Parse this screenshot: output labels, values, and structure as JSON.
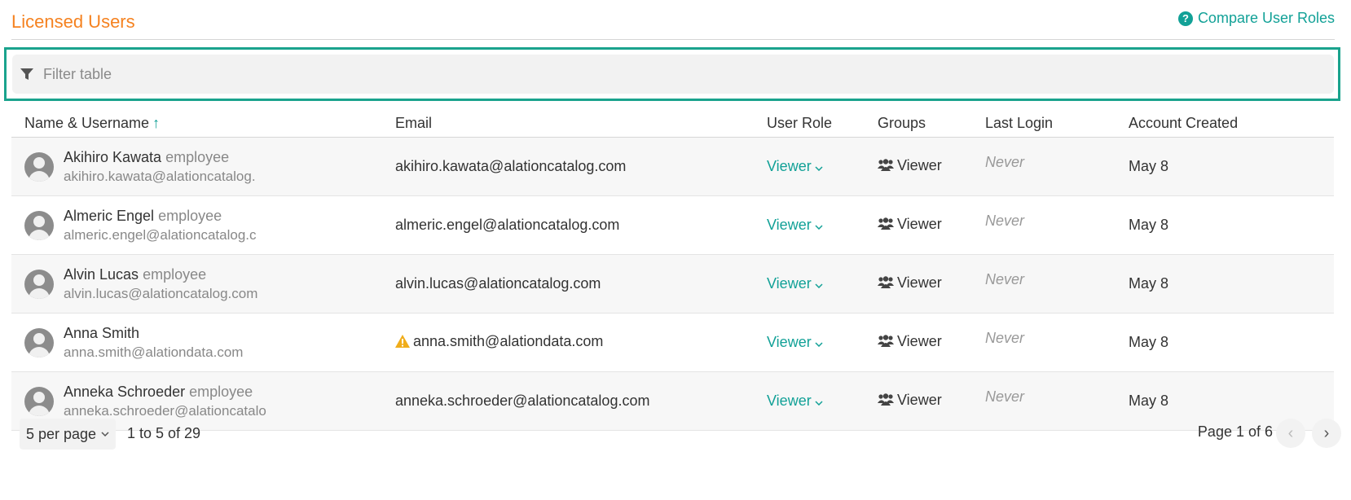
{
  "header": {
    "title": "Licensed Users",
    "compare_link": "Compare User Roles",
    "help_glyph": "?"
  },
  "filter": {
    "placeholder": "Filter table",
    "value": ""
  },
  "table": {
    "columns": [
      "Name & Username",
      "Email",
      "User Role",
      "Groups",
      "Last Login",
      "Account Created"
    ],
    "sort_indicator": "↑",
    "rows": [
      {
        "full_name": "Akihiro Kawata",
        "tag": "employee",
        "username": "akihiro.kawata@alationcatalog.",
        "email": "akihiro.kawata@alationcatalog.com",
        "role": "Viewer",
        "group": "Viewer",
        "last_login": "Never",
        "created": "May 8"
      },
      {
        "full_name": "Almeric Engel",
        "tag": "employee",
        "username": "almeric.engel@alationcatalog.c",
        "email": "almeric.engel@alationcatalog.com",
        "role": "Viewer",
        "group": "Viewer",
        "last_login": "Never",
        "created": "May 8"
      },
      {
        "full_name": "Alvin Lucas",
        "tag": "employee",
        "username": "alvin.lucas@alationcatalog.com",
        "email": "alvin.lucas@alationcatalog.com",
        "role": "Viewer",
        "group": "Viewer",
        "last_login": "Never",
        "created": "May 8"
      },
      {
        "full_name": "Anna Smith",
        "tag": "",
        "username": "anna.smith@alationdata.com",
        "email": "anna.smith@alationdata.com",
        "email_warning": true,
        "role": "Viewer",
        "group": "Viewer",
        "last_login": "Never",
        "created": "May 8"
      },
      {
        "full_name": "Anneka Schroeder",
        "tag": "employee",
        "username": "anneka.schroeder@alationcatalo",
        "email": "anneka.schroeder@alationcatalog.com",
        "role": "Viewer",
        "group": "Viewer",
        "last_login": "Never",
        "created": "May 8"
      }
    ]
  },
  "pagination": {
    "per_page": "5 per page",
    "range": "1 to 5 of 29",
    "page_info": "Page 1 of 6",
    "prev_glyph": "‹",
    "next_glyph": "›"
  },
  "colors": {
    "title": "#f58220",
    "accent": "#12a197",
    "highlight_outline": "#1aa38d",
    "warning": "#f0ad1b"
  },
  "icons": [
    "question-circle-icon",
    "filter-icon",
    "sort-up-arrow-icon",
    "user-avatar-icon",
    "warning-icon",
    "chevron-down-icon",
    "group-icon",
    "chevron-left-icon",
    "chevron-right-icon"
  ]
}
